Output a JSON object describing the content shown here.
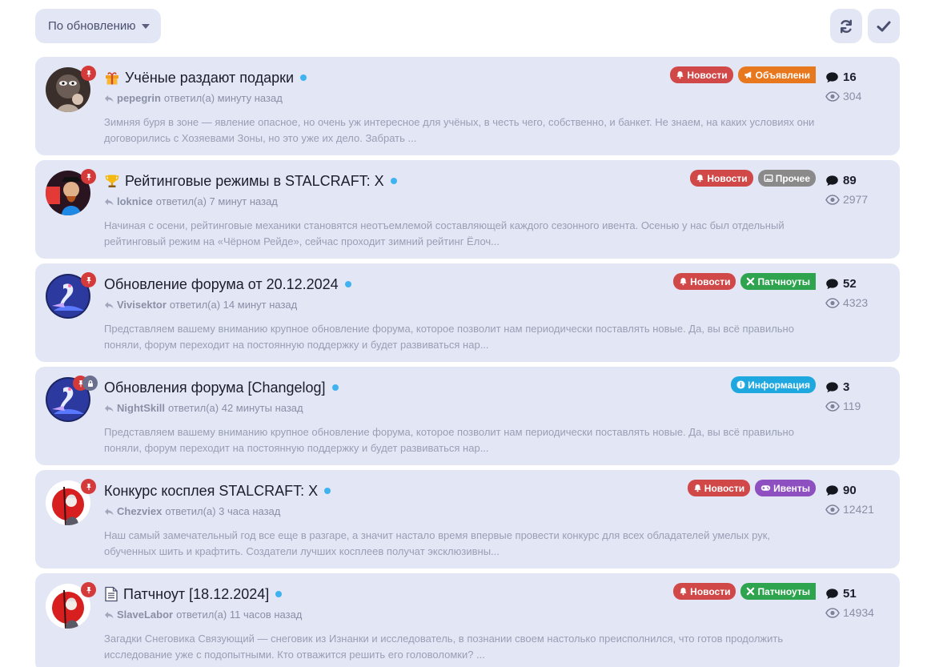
{
  "toolbar": {
    "sort_label": "По обновлению",
    "refresh_icon": "refresh-icon",
    "mark_read_icon": "check-icon"
  },
  "colors": {
    "card_bg": "#e3e6f5",
    "news": "#d04848",
    "announce": "#e8781e",
    "other": "#8a8a8a",
    "patch": "#2ea44f",
    "info": "#1fa8e0",
    "events": "#8e4fc0",
    "unread_dot": "#3fb3f0",
    "pin": "#d53a3a"
  },
  "topics": [
    {
      "title": "Учёные раздают подарки",
      "title_icon": "gift-icon",
      "user": "pepegrin",
      "action": "ответил(а) минуту назад",
      "excerpt": "Зимняя буря в зоне — явление опасное, но очень уж интересное для учёных, в честь чего, собственно, и банкет. Не знаем, на каких условиях они договорились с Хозяевами Зоны, но это уже их дело. Забрать ...",
      "tags": [
        "Новости",
        "Объявлени"
      ],
      "replies": "16",
      "views": "304"
    },
    {
      "title": "Рейтинговые режимы в STALCRAFT: X",
      "title_icon": "trophy-icon",
      "user": "loknice",
      "action": "ответил(а) 7 минут назад",
      "excerpt": "Начиная с осени, рейтинговые механики становятся неотъемлемой составляющей каждого сезонного ивента. Осенью у нас был отдельный рейтинговый режим на «Чёрном Рейде», сейчас проходит зимний рейтинг Ёлоч...",
      "tags": [
        "Новости",
        "Прочее"
      ],
      "replies": "89",
      "views": "2977"
    },
    {
      "title": "Обновление форума от 20.12.2024",
      "title_icon": "",
      "user": "Vivisektor",
      "action": "ответил(а) 14 минут назад",
      "excerpt": "Представляем вашему вниманию крупное обновление форума, которое позволит нам периодически поставлять новые. Да, вы всё правильно поняли, форум переходит на постоянную поддержку и будет развиваться нар...",
      "tags": [
        "Новости",
        "Патчноуты"
      ],
      "replies": "52",
      "views": "4323"
    },
    {
      "title": "Обновления форума [Changelog]",
      "title_icon": "",
      "user": "NightSkill",
      "action": "ответил(а) 42 минуты назад",
      "excerpt": "Представляем вашему вниманию крупное обновление форума, которое позволит нам периодически поставлять новые. Да, вы всё правильно поняли, форум переходит на постоянную поддержку и будет развиваться нар...",
      "tags": [
        "Информация"
      ],
      "replies": "3",
      "views": "119"
    },
    {
      "title": "Конкурс косплея STALCRAFT: X",
      "title_icon": "",
      "user": "Chezviex",
      "action": "ответил(а) 3 часа назад",
      "excerpt": "Наш самый замечательный год все еще в разгаре, а значит настало время впервые провести конкурс для всех обладателей умелых рук, обученных шить и крафтить. Создатели лучших косплеев получат эксклюзивны...",
      "tags": [
        "Новости",
        "Ивенты"
      ],
      "replies": "90",
      "views": "12421"
    },
    {
      "title": "Патчноут [18.12.2024]",
      "title_icon": "document-icon",
      "user": "SlaveLabor",
      "action": "ответил(а) 11 часов назад",
      "excerpt": "Загадки Снеговика Связующий — снеговик из Изнанки и исследователь, в познании своем настолько преисполнился, что готов продолжить исследование уже с подопытными. Кто отважится решить его головоломки? ...",
      "tags": [
        "Новости",
        "Патчноуты"
      ],
      "replies": "51",
      "views": "14934"
    }
  ]
}
